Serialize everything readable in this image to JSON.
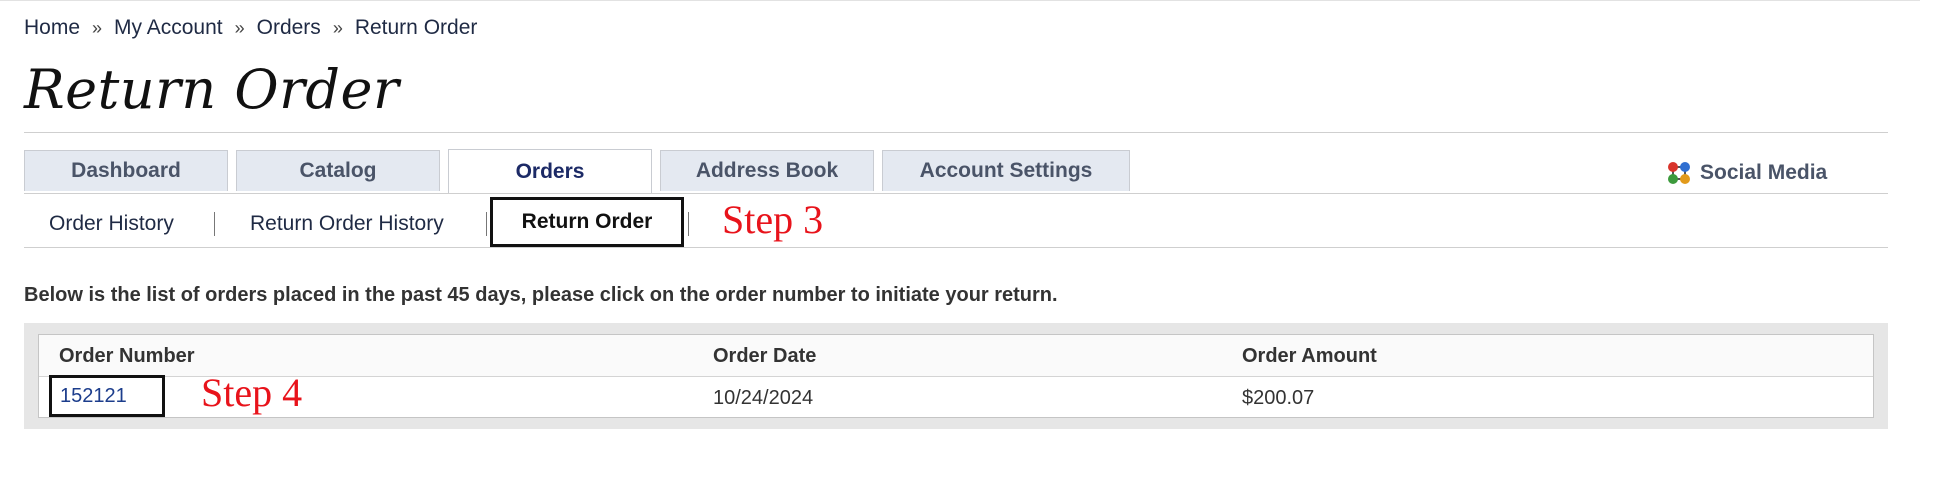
{
  "breadcrumb": {
    "items": [
      "Home",
      "My Account",
      "Orders",
      "Return Order"
    ],
    "separator": "»"
  },
  "page_title": "Return Order",
  "tabs": [
    {
      "label": "Dashboard",
      "active": false
    },
    {
      "label": "Catalog",
      "active": false
    },
    {
      "label": "Orders",
      "active": true
    },
    {
      "label": "Address Book",
      "active": false
    },
    {
      "label": "Account Settings",
      "active": false
    }
  ],
  "social": {
    "label": "Social Media",
    "icon": "social-network-icon"
  },
  "subnav": {
    "items": [
      "Order History",
      "Return Order History",
      "Return Order"
    ],
    "active": "Return Order"
  },
  "annotations": {
    "step3": "Step 3",
    "step4": "Step 4",
    "color": "#e8131b"
  },
  "instruction": "Below is the list of orders placed in the past 45 days, please click on the order number to initiate your return.",
  "table": {
    "columns": [
      "Order Number",
      "Order Date",
      "Order Amount"
    ],
    "rows": [
      {
        "order_number": "152121",
        "order_date": "10/24/2024",
        "order_amount": "$200.07"
      }
    ]
  }
}
